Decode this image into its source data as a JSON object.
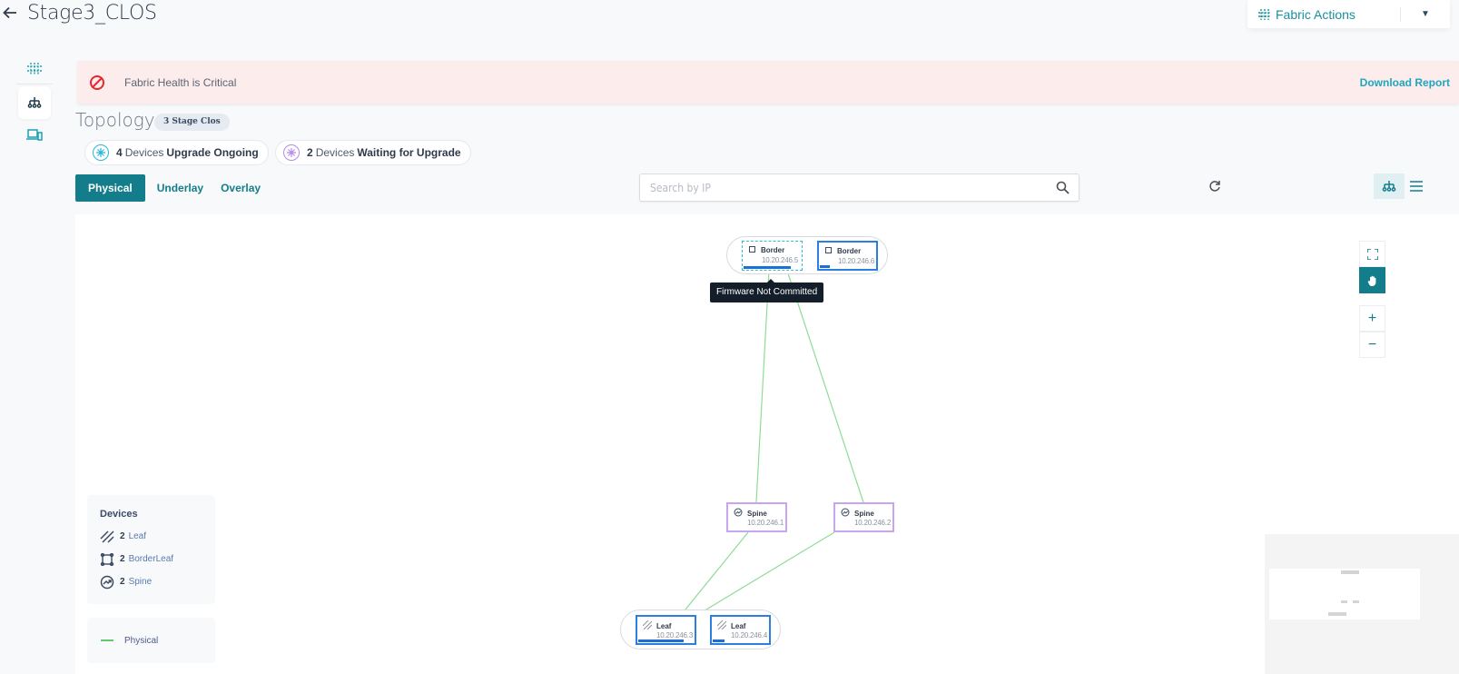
{
  "header": {
    "title": "Stage3_CLOS",
    "back_icon": "arrow-left-icon",
    "actions": {
      "label": "Fabric Actions",
      "icon": "fabric-icon",
      "dropdown_icon": "caret-down-icon"
    }
  },
  "sidenav": {
    "items": [
      {
        "name": "fabric",
        "icon": "fabric-icon",
        "active": false
      },
      {
        "name": "topology",
        "icon": "topology-icon",
        "active": true
      },
      {
        "name": "devices",
        "icon": "devices-icon",
        "active": false
      }
    ]
  },
  "alert": {
    "icon": "blocked-icon",
    "message": "Fabric Health is Critical",
    "action": "Download Report",
    "color": "#e5262e"
  },
  "topology": {
    "title": "Topology",
    "badge": "3 Stage Clos",
    "statuses": [
      {
        "count": "4",
        "label": "Devices",
        "status": "Upgrade Ongoing",
        "color": "#29b6d6"
      },
      {
        "count": "2",
        "label": "Devices",
        "status": "Waiting for Upgrade",
        "color": "#b48be8"
      }
    ],
    "tabs": [
      {
        "label": "Physical",
        "active": true
      },
      {
        "label": "Underlay",
        "active": false
      },
      {
        "label": "Overlay",
        "active": false
      }
    ],
    "search": {
      "placeholder": "Search by IP",
      "value": ""
    },
    "view_modes": [
      "topology-view",
      "list-view"
    ]
  },
  "graph": {
    "tooltip": "Firmware Not Committed",
    "nodes": [
      {
        "id": "b1",
        "role": "Border",
        "ip": "10.20.246.5",
        "state": "upgrade-ongoing",
        "progress": 0.8
      },
      {
        "id": "b2",
        "role": "Border",
        "ip": "10.20.246.6",
        "state": "upgrade-ongoing",
        "progress": 0.18
      },
      {
        "id": "s1",
        "role": "Spine",
        "ip": "10.20.246.1",
        "state": "waiting"
      },
      {
        "id": "s2",
        "role": "Spine",
        "ip": "10.20.246.2",
        "state": "waiting"
      },
      {
        "id": "l1",
        "role": "Leaf",
        "ip": "10.20.246.3",
        "state": "upgrade-ongoing",
        "progress": 0.8
      },
      {
        "id": "l2",
        "role": "Leaf",
        "ip": "10.20.246.4",
        "state": "upgrade-ongoing",
        "progress": 0.2
      }
    ],
    "links": [
      {
        "from": "b1",
        "to": "s1",
        "type": "Physical"
      },
      {
        "from": "b1",
        "to": "s2",
        "type": "Physical"
      },
      {
        "from": "s1",
        "to": "l1",
        "type": "Physical"
      },
      {
        "from": "s2",
        "to": "l1",
        "type": "Physical"
      }
    ],
    "link_color": "#8fdc95"
  },
  "legend": {
    "title": "Devices",
    "items": [
      {
        "count": "2",
        "label": "Leaf",
        "icon": "leaf-icon"
      },
      {
        "count": "2",
        "label": "BorderLeaf",
        "icon": "borderleaf-icon"
      },
      {
        "count": "2",
        "label": "Spine",
        "icon": "spine-icon"
      }
    ],
    "links": [
      {
        "label": "Physical",
        "color": "#5dcb6a"
      }
    ]
  },
  "controls": [
    "fit-screen",
    "pan",
    "zoom-in",
    "zoom-out"
  ]
}
